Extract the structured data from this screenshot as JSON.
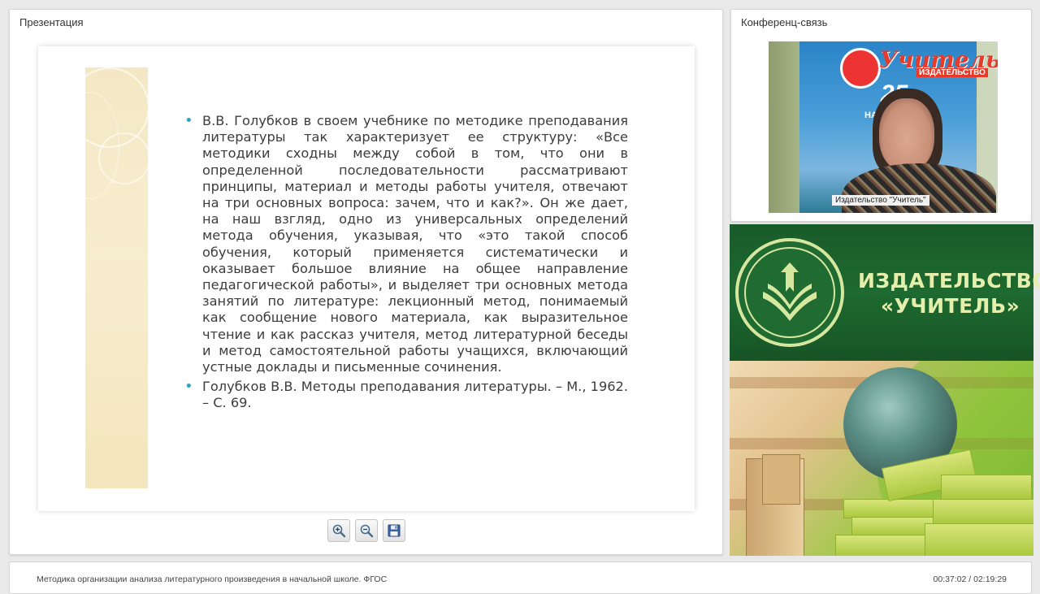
{
  "presentation_panel": {
    "title": "Презентация"
  },
  "conference_panel": {
    "title": "Конференц-связь"
  },
  "slide": {
    "bullets": [
      "В.В. Голубков в своем учебнике по методике преподавания литературы так характеризует ее структуру: «Все методики сходны между собой в том, что они в определенной последовательности рассматривают принципы, материал и методы работы учителя, отвечают на три основных вопроса: зачем, что и как?». Он же дает, на наш взгляд, одно из универсальных определений метода обучения, указывая, что «это такой способ обучения, который применяется систематически и оказывает большое влияние на общее направление педагогической работы», и выделяет три основных метода занятий по литературе: лекционный метод, понимаемый как сообщение нового материала, как выразительное чтение и как рассказ учителя, метод литературной беседы и метод самостоятельной работы учащихся, включающий устные доклады и письменные сочинения.",
      "Голубков В.В. Методы преподавания литературы. – М., 1962. – С. 69."
    ],
    "bullet_color": "#3aa3c4"
  },
  "toolbar": {
    "zoom_in_icon": "zoom-in-icon",
    "zoom_out_icon": "zoom-out-icon",
    "save_icon": "floppy-disk-icon"
  },
  "video": {
    "caption": "Издательство \"Учитель\"",
    "banner_text": "Учитель",
    "banner_subtext": "ИЗДАТЕЛЬСТВО",
    "anniversary": "25",
    "anniversary_sub": "НА КНИЖ"
  },
  "publisher": {
    "line1": "ИЗДАТЕЛЬСТВО",
    "line2": "«УЧИТЕЛЬ»",
    "accent_color": "#e6eeab",
    "background_color": "#1e6a30"
  },
  "footer": {
    "course_title": "Методика организации анализа литературного произведения в начальной школе. ФГОС",
    "time": "00:37:02 / 02:19:29"
  }
}
